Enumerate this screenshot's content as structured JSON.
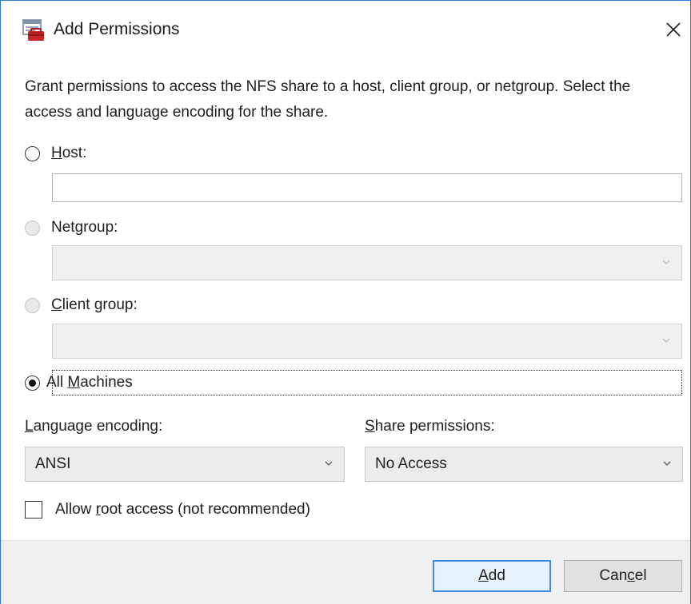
{
  "window": {
    "title": "Add Permissions",
    "icon": "nfs-share-icon",
    "close_label": "✕"
  },
  "description": "Grant permissions to access the NFS share to a host, client group, or netgroup. Select the access and language encoding for the share.",
  "target_options": {
    "host": {
      "pre": "",
      "accel": "H",
      "post": "ost:",
      "enabled": true,
      "checked": false,
      "input_value": ""
    },
    "netgroup": {
      "pre": "Net",
      "accel": "g",
      "post": "roup:",
      "enabled": false,
      "checked": false,
      "selected_value": ""
    },
    "client_group": {
      "pre": "",
      "accel": "C",
      "post": "lient group:",
      "enabled": false,
      "checked": false,
      "selected_value": ""
    },
    "all_machines": {
      "pre": "All ",
      "accel": "M",
      "post": "achines",
      "enabled": true,
      "checked": true
    }
  },
  "language_encoding": {
    "pre": "",
    "accel": "L",
    "post": "anguage encoding:",
    "selected_value": "ANSI"
  },
  "share_permissions": {
    "pre": "",
    "accel": "S",
    "post": "hare permissions:",
    "selected_value": "No Access"
  },
  "allow_root": {
    "pre": "Allow ",
    "accel": "r",
    "post": "oot access (not recommended)",
    "checked": false
  },
  "buttons": {
    "add": {
      "pre": "",
      "accel": "A",
      "post": "dd"
    },
    "cancel": {
      "pre": "Can",
      "accel": "c",
      "post": "el"
    }
  },
  "colors": {
    "window_border": "#2b7bd6",
    "default_button_border": "#3c8ee0",
    "footer_bg": "#f0f0f0"
  }
}
